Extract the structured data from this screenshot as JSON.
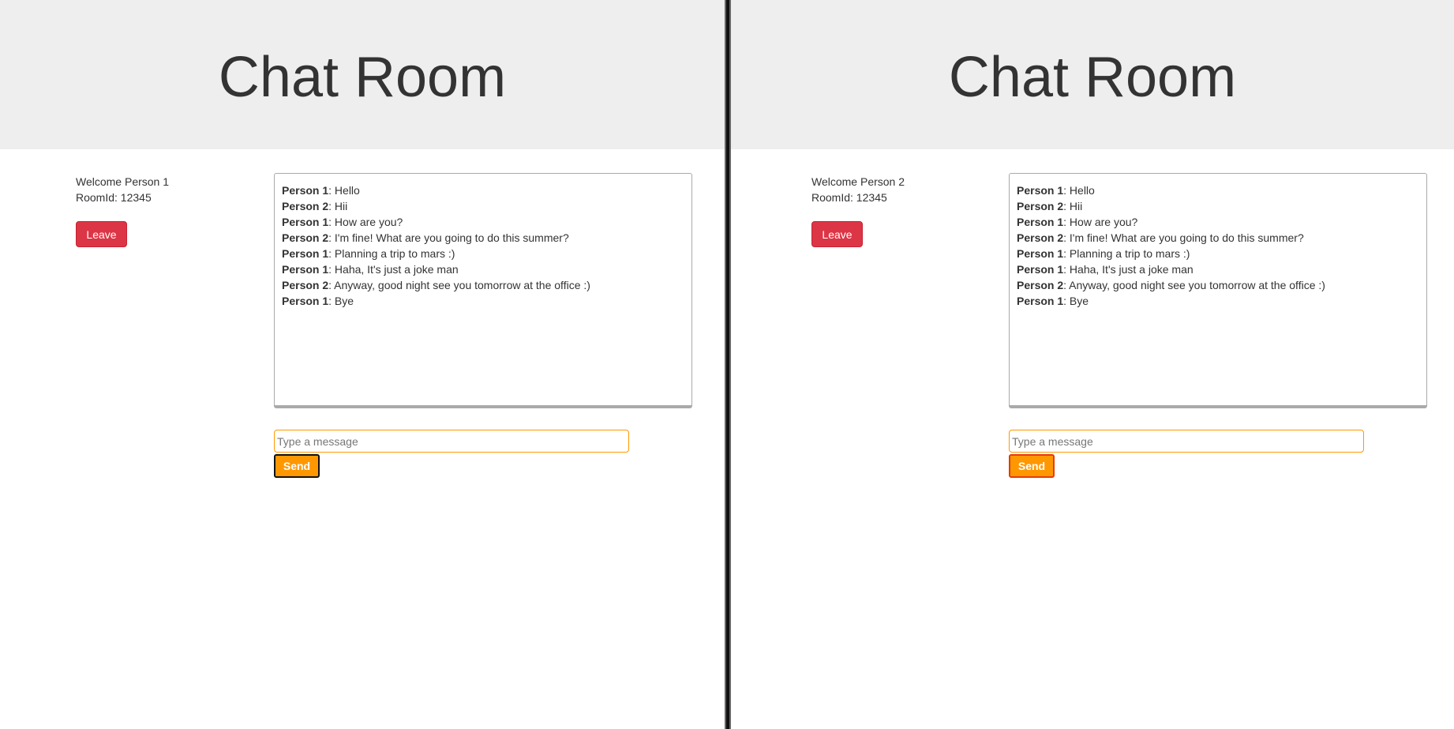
{
  "panes": [
    {
      "title": "Chat Room",
      "welcome": "Welcome Person 1",
      "room": "RoomId: 12345",
      "leave_label": "Leave",
      "input_placeholder": "Type a message",
      "input_value": "",
      "send_label": "Send"
    },
    {
      "title": "Chat Room",
      "welcome": "Welcome Person 2",
      "room": "RoomId: 12345",
      "leave_label": "Leave",
      "input_placeholder": "Type a message",
      "input_value": "",
      "send_label": "Send"
    }
  ],
  "messages": [
    {
      "sender": "Person 1",
      "text": ": Hello"
    },
    {
      "sender": "Person 2",
      "text": ": Hii"
    },
    {
      "sender": "Person 1",
      "text": ": How are you?"
    },
    {
      "sender": "Person 2",
      "text": ": I'm fine! What are you going to do this summer?"
    },
    {
      "sender": "Person 1",
      "text": ": Planning a trip to mars :)"
    },
    {
      "sender": "Person 1",
      "text": ": Haha, It's just a joke man"
    },
    {
      "sender": "Person 2",
      "text": ": Anyway, good night see you tomorrow at the office :)"
    },
    {
      "sender": "Person 1",
      "text": ": Bye"
    }
  ],
  "colors": {
    "header_bg": "#eeeeee",
    "leave": "#dc3545",
    "send": "#ff9800"
  }
}
